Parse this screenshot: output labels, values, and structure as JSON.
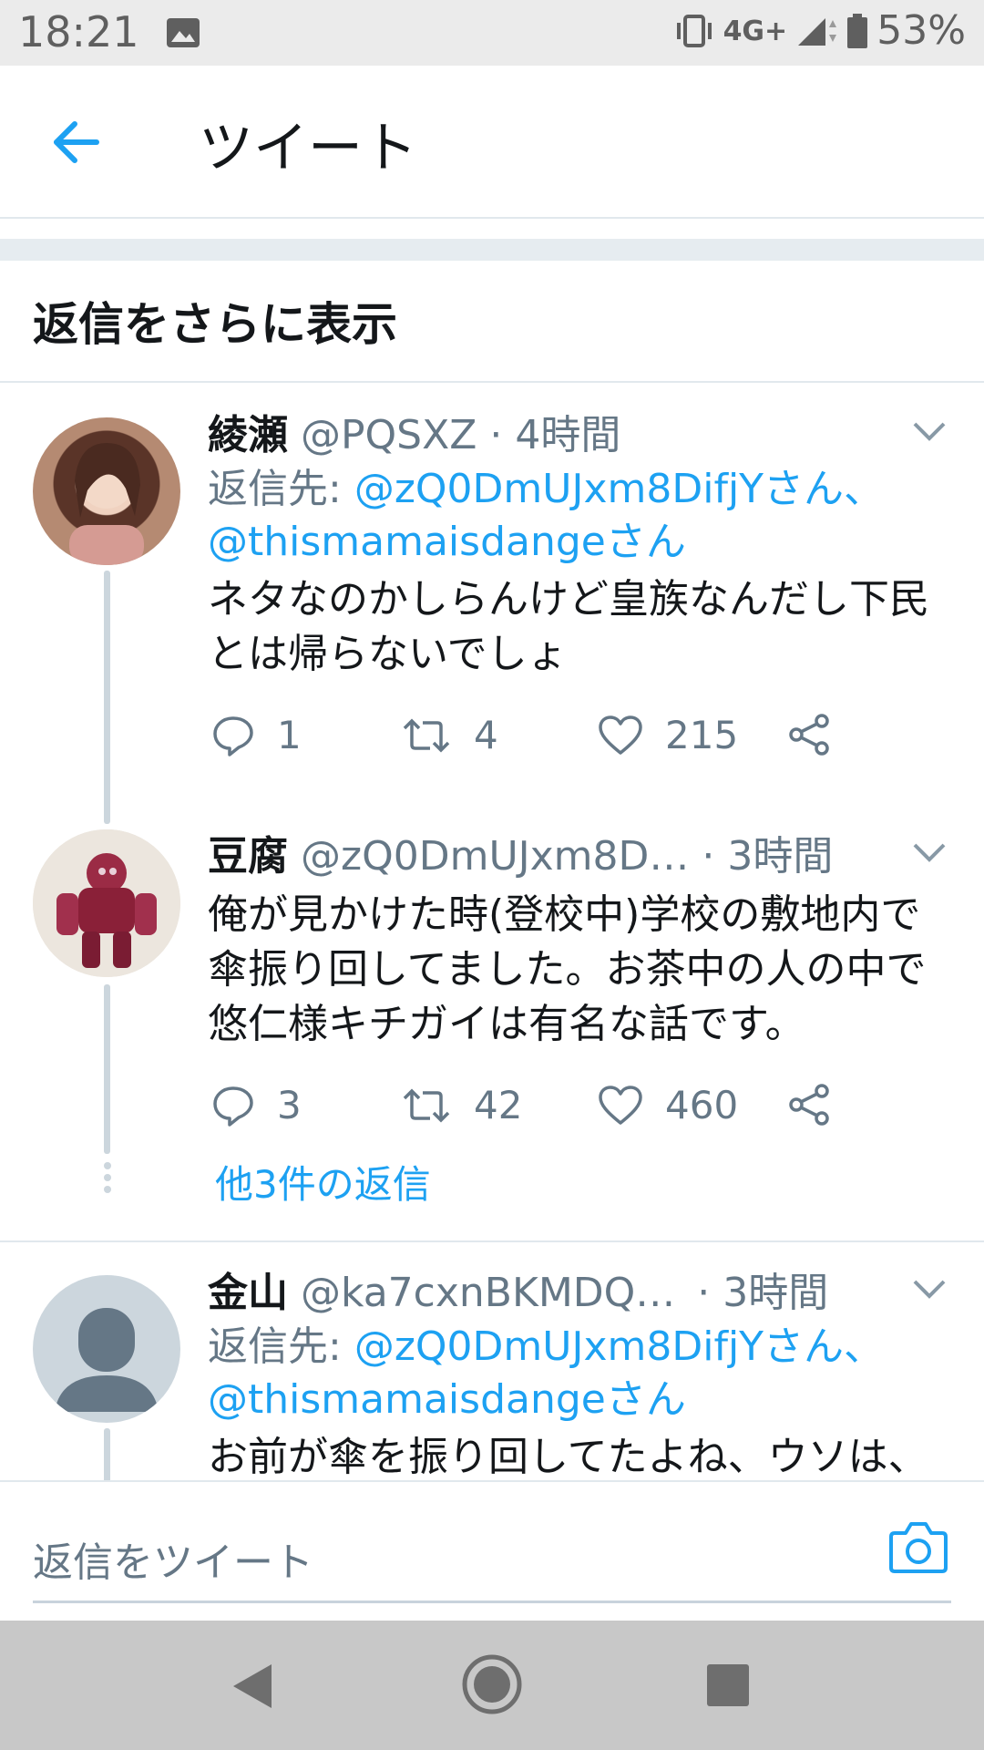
{
  "status_bar": {
    "time": "18:21",
    "network": "4G+",
    "battery": "53%",
    "icons": [
      "image-notification-icon",
      "vibrate-icon",
      "signal-icon",
      "battery-icon"
    ]
  },
  "header": {
    "title": "ツイート",
    "back_icon": "arrow-left-icon"
  },
  "more_replies_label": "返信をさらに表示",
  "tweets": [
    {
      "name": "綾瀬",
      "handle": "@PQSXZ",
      "time": "· 4時間",
      "reply_prefix": "返信先: ",
      "reply_to_1": "@zQ0DmUJxm8DifjYさん、",
      "reply_to_2": "@thismamaisdangeさん",
      "text_line1": "ネタなのかしらんけど皇族なんだし下民",
      "text_line2": "とは帰らないでしょ",
      "replies": "1",
      "retweets": "4",
      "likes": "215"
    },
    {
      "name": "豆腐",
      "handle": "@zQ0DmUJxm8D…",
      "time": "· 3時間",
      "text_line1": "俺が見かけた時(登校中)学校の敷地内で",
      "text_line2": "傘振り回してました。お茶中の人の中で",
      "text_line3": "悠仁様キチガイは有名な話です。",
      "replies": "3",
      "retweets": "42",
      "likes": "460",
      "more_replies": "他3件の返信"
    },
    {
      "name": "金山",
      "handle": "@ka7cxnBKMDQ…",
      "time": "· 3時間",
      "reply_prefix": "返信先: ",
      "reply_to_1": "@zQ0DmUJxm8DifjYさん、",
      "reply_to_2": "@thismamaisdangeさん",
      "text_line1": "お前が傘を振り回してたよね、ウソは、"
    }
  ],
  "compose": {
    "placeholder": "返信をツイート",
    "camera_icon": "camera-icon"
  },
  "colors": {
    "accent": "#1da1f2",
    "secondary_text": "#657786",
    "divider": "#e1e8ed"
  }
}
